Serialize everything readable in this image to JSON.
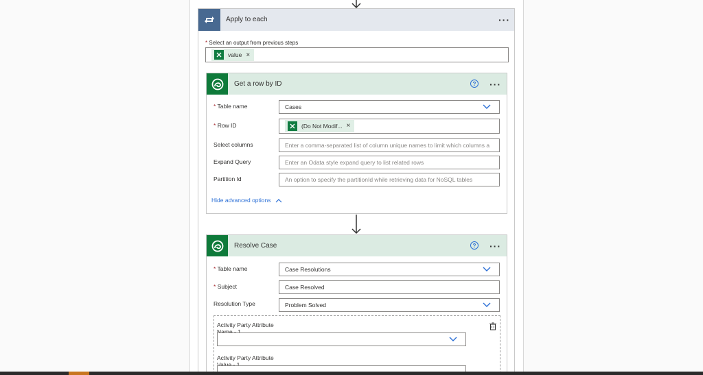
{
  "apply_each": {
    "title": "Apply to each",
    "menu": "···",
    "field_required": "*",
    "field_label": "Select an output from previous steps",
    "token_label": "value",
    "token_close": "×"
  },
  "get_row": {
    "title": "Get a row by ID",
    "help": "?",
    "menu": "···",
    "fields": {
      "table_required": "*",
      "table_label": "Table name",
      "table_value": "Cases",
      "row_required": "*",
      "row_label": "Row ID",
      "row_token": "(Do Not Modif...",
      "row_token_close": "×",
      "select_label": "Select columns",
      "select_placeholder": "Enter a comma-separated list of column unique names to limit which columns a",
      "expand_label": "Expand Query",
      "expand_placeholder": "Enter an Odata style expand query to list related rows",
      "partition_label": "Partition Id",
      "partition_placeholder": "An option to specify the partitionId while retrieving data for NoSQL tables"
    },
    "advanced_link": "Hide advanced options"
  },
  "resolve_case": {
    "title": "Resolve Case",
    "help": "?",
    "menu": "···",
    "fields": {
      "table_required": "*",
      "table_label": "Table name",
      "table_value": "Case Resolutions",
      "subject_required": "*",
      "subject_label": "Subject",
      "subject_value": "Case Resolved",
      "resolution_label": "Resolution Type",
      "resolution_value": "Problem Solved",
      "party_name_label_1": "Activity Party Attribute",
      "party_name_label_2": "Name - 1",
      "party_value_label_1": "Activity Party Attribute",
      "party_value_label_2": "Value - 1"
    }
  },
  "colors": {
    "loop_accent": "#486991",
    "dataverse_accent": "#0e7a3a",
    "excel_green": "#107c41",
    "link_blue": "#2b6fd6",
    "required_red": "#a4262c"
  },
  "icons": {
    "loop": "loop-icon",
    "dataverse": "dataverse-icon",
    "excel": "excel-icon",
    "chevron": "chevron-down-icon",
    "help": "help-icon",
    "trash": "delete-item-icon"
  }
}
